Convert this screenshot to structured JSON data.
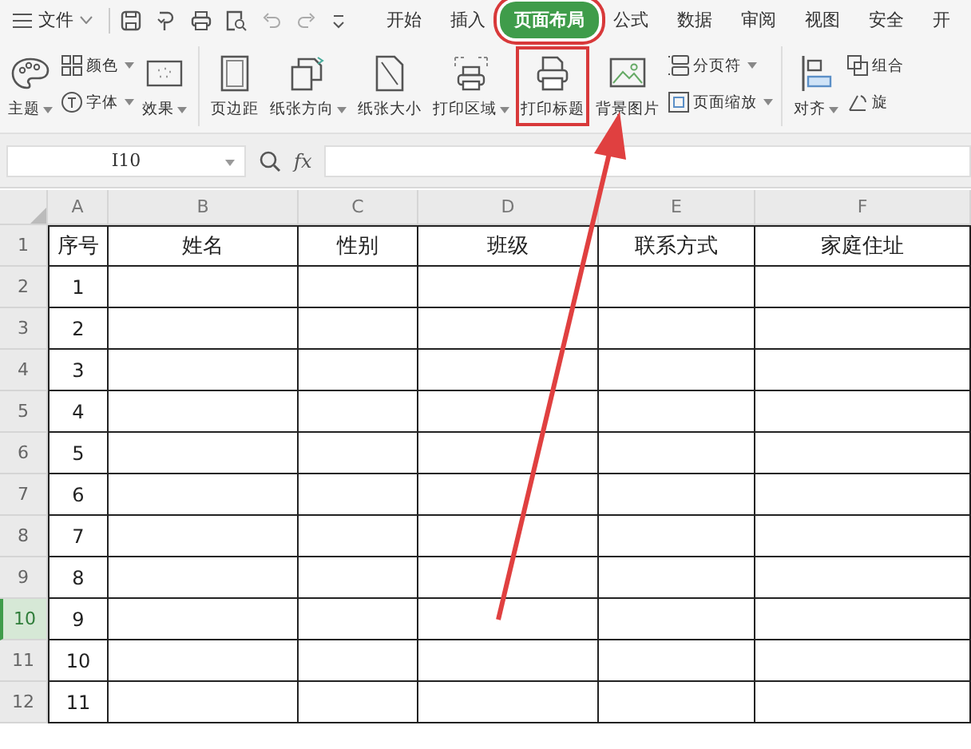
{
  "menu": {
    "label": "文件"
  },
  "tabs": [
    {
      "label": "开始",
      "selected": false,
      "highlighted": false
    },
    {
      "label": "插入",
      "selected": false,
      "highlighted": false
    },
    {
      "label": "页面布局",
      "selected": true,
      "highlighted": true
    },
    {
      "label": "公式",
      "selected": false,
      "highlighted": false
    },
    {
      "label": "数据",
      "selected": false,
      "highlighted": false
    },
    {
      "label": "审阅",
      "selected": false,
      "highlighted": false
    },
    {
      "label": "视图",
      "selected": false,
      "highlighted": false
    },
    {
      "label": "安全",
      "selected": false,
      "highlighted": false
    },
    {
      "label": "开",
      "selected": false,
      "highlighted": false
    }
  ],
  "ribbon": [
    {
      "kind": "large",
      "label": "主题",
      "dropdown": true,
      "highlighted": false
    },
    {
      "kind": "stack",
      "items": [
        {
          "label": "颜色",
          "dropdown": true
        },
        {
          "label": "字体",
          "dropdown": true
        }
      ]
    },
    {
      "kind": "large",
      "label": "效果",
      "dropdown": true,
      "highlighted": false
    },
    {
      "kind": "separator"
    },
    {
      "kind": "large",
      "label": "页边距",
      "dropdown": false,
      "highlighted": false
    },
    {
      "kind": "large",
      "label": "纸张方向",
      "dropdown": true,
      "highlighted": false
    },
    {
      "kind": "large",
      "label": "纸张大小",
      "dropdown": false,
      "highlighted": false
    },
    {
      "kind": "large",
      "label": "打印区域",
      "dropdown": true,
      "highlighted": false
    },
    {
      "kind": "large",
      "label": "打印标题",
      "dropdown": false,
      "highlighted": true
    },
    {
      "kind": "large",
      "label": "背景图片",
      "dropdown": false,
      "highlighted": false
    },
    {
      "kind": "stack",
      "items": [
        {
          "label": "分页符",
          "dropdown": true
        },
        {
          "label": "页面缩放",
          "dropdown": true
        }
      ]
    },
    {
      "kind": "separator"
    },
    {
      "kind": "large",
      "label": "对齐",
      "dropdown": true,
      "highlighted": false
    },
    {
      "kind": "stack",
      "items": [
        {
          "label": "组合",
          "dropdown": false
        },
        {
          "label": "旋",
          "dropdown": false
        }
      ]
    }
  ],
  "formula_bar": {
    "name_box": "I10",
    "function_label": "fx"
  },
  "sheet": {
    "columns": [
      "A",
      "B",
      "C",
      "D",
      "E",
      "F"
    ],
    "rows": [
      {
        "header": "1",
        "selected": false,
        "cells": [
          "序号",
          "姓名",
          "性别",
          "班级",
          "联系方式",
          "家庭住址"
        ]
      },
      {
        "header": "2",
        "selected": false,
        "cells": [
          "1"
        ]
      },
      {
        "header": "3",
        "selected": false,
        "cells": [
          "2"
        ]
      },
      {
        "header": "4",
        "selected": false,
        "cells": [
          "3"
        ]
      },
      {
        "header": "5",
        "selected": false,
        "cells": [
          "4"
        ]
      },
      {
        "header": "6",
        "selected": false,
        "cells": [
          "5"
        ]
      },
      {
        "header": "7",
        "selected": false,
        "cells": [
          "6"
        ]
      },
      {
        "header": "8",
        "selected": false,
        "cells": [
          "7"
        ]
      },
      {
        "header": "9",
        "selected": false,
        "cells": [
          "8"
        ]
      },
      {
        "header": "10",
        "selected": true,
        "cells": [
          "9"
        ]
      },
      {
        "header": "11",
        "selected": false,
        "cells": [
          "10"
        ]
      },
      {
        "header": "12",
        "selected": false,
        "cells": [
          "11"
        ]
      }
    ]
  }
}
